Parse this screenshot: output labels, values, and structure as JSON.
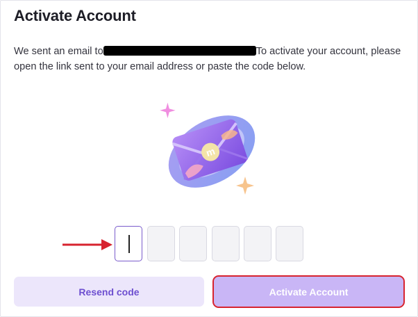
{
  "header": {
    "title": "Activate Account"
  },
  "message": {
    "prefix": "We sent an email to",
    "suffix": "To activate your account, please open the link sent to your email address or paste the code below."
  },
  "illustration": {
    "icon": "envelope-logo-icon",
    "logo_text": "m"
  },
  "code_input": {
    "length": 6,
    "active_index": 0,
    "values": [
      "",
      "",
      "",
      "",
      "",
      ""
    ]
  },
  "buttons": {
    "resend_label": "Resend code",
    "activate_label": "Activate Account"
  },
  "colors": {
    "accent": "#7a5ccc",
    "resend_bg": "#ece6fb",
    "activate_bg": "#c9b6f6",
    "highlight_red": "#d7232f"
  }
}
